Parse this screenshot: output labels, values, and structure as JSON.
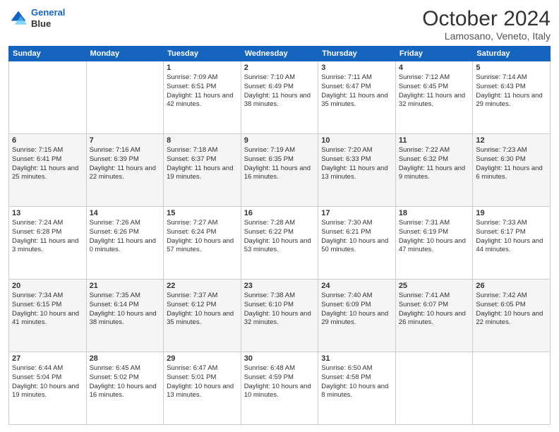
{
  "header": {
    "logo_line1": "General",
    "logo_line2": "Blue",
    "month": "October 2024",
    "location": "Lamosano, Veneto, Italy"
  },
  "weekdays": [
    "Sunday",
    "Monday",
    "Tuesday",
    "Wednesday",
    "Thursday",
    "Friday",
    "Saturday"
  ],
  "weeks": [
    [
      {
        "day": "",
        "sunrise": "",
        "sunset": "",
        "daylight": ""
      },
      {
        "day": "",
        "sunrise": "",
        "sunset": "",
        "daylight": ""
      },
      {
        "day": "1",
        "sunrise": "Sunrise: 7:09 AM",
        "sunset": "Sunset: 6:51 PM",
        "daylight": "Daylight: 11 hours and 42 minutes."
      },
      {
        "day": "2",
        "sunrise": "Sunrise: 7:10 AM",
        "sunset": "Sunset: 6:49 PM",
        "daylight": "Daylight: 11 hours and 38 minutes."
      },
      {
        "day": "3",
        "sunrise": "Sunrise: 7:11 AM",
        "sunset": "Sunset: 6:47 PM",
        "daylight": "Daylight: 11 hours and 35 minutes."
      },
      {
        "day": "4",
        "sunrise": "Sunrise: 7:12 AM",
        "sunset": "Sunset: 6:45 PM",
        "daylight": "Daylight: 11 hours and 32 minutes."
      },
      {
        "day": "5",
        "sunrise": "Sunrise: 7:14 AM",
        "sunset": "Sunset: 6:43 PM",
        "daylight": "Daylight: 11 hours and 29 minutes."
      }
    ],
    [
      {
        "day": "6",
        "sunrise": "Sunrise: 7:15 AM",
        "sunset": "Sunset: 6:41 PM",
        "daylight": "Daylight: 11 hours and 25 minutes."
      },
      {
        "day": "7",
        "sunrise": "Sunrise: 7:16 AM",
        "sunset": "Sunset: 6:39 PM",
        "daylight": "Daylight: 11 hours and 22 minutes."
      },
      {
        "day": "8",
        "sunrise": "Sunrise: 7:18 AM",
        "sunset": "Sunset: 6:37 PM",
        "daylight": "Daylight: 11 hours and 19 minutes."
      },
      {
        "day": "9",
        "sunrise": "Sunrise: 7:19 AM",
        "sunset": "Sunset: 6:35 PM",
        "daylight": "Daylight: 11 hours and 16 minutes."
      },
      {
        "day": "10",
        "sunrise": "Sunrise: 7:20 AM",
        "sunset": "Sunset: 6:33 PM",
        "daylight": "Daylight: 11 hours and 13 minutes."
      },
      {
        "day": "11",
        "sunrise": "Sunrise: 7:22 AM",
        "sunset": "Sunset: 6:32 PM",
        "daylight": "Daylight: 11 hours and 9 minutes."
      },
      {
        "day": "12",
        "sunrise": "Sunrise: 7:23 AM",
        "sunset": "Sunset: 6:30 PM",
        "daylight": "Daylight: 11 hours and 6 minutes."
      }
    ],
    [
      {
        "day": "13",
        "sunrise": "Sunrise: 7:24 AM",
        "sunset": "Sunset: 6:28 PM",
        "daylight": "Daylight: 11 hours and 3 minutes."
      },
      {
        "day": "14",
        "sunrise": "Sunrise: 7:26 AM",
        "sunset": "Sunset: 6:26 PM",
        "daylight": "Daylight: 11 hours and 0 minutes."
      },
      {
        "day": "15",
        "sunrise": "Sunrise: 7:27 AM",
        "sunset": "Sunset: 6:24 PM",
        "daylight": "Daylight: 10 hours and 57 minutes."
      },
      {
        "day": "16",
        "sunrise": "Sunrise: 7:28 AM",
        "sunset": "Sunset: 6:22 PM",
        "daylight": "Daylight: 10 hours and 53 minutes."
      },
      {
        "day": "17",
        "sunrise": "Sunrise: 7:30 AM",
        "sunset": "Sunset: 6:21 PM",
        "daylight": "Daylight: 10 hours and 50 minutes."
      },
      {
        "day": "18",
        "sunrise": "Sunrise: 7:31 AM",
        "sunset": "Sunset: 6:19 PM",
        "daylight": "Daylight: 10 hours and 47 minutes."
      },
      {
        "day": "19",
        "sunrise": "Sunrise: 7:33 AM",
        "sunset": "Sunset: 6:17 PM",
        "daylight": "Daylight: 10 hours and 44 minutes."
      }
    ],
    [
      {
        "day": "20",
        "sunrise": "Sunrise: 7:34 AM",
        "sunset": "Sunset: 6:15 PM",
        "daylight": "Daylight: 10 hours and 41 minutes."
      },
      {
        "day": "21",
        "sunrise": "Sunrise: 7:35 AM",
        "sunset": "Sunset: 6:14 PM",
        "daylight": "Daylight: 10 hours and 38 minutes."
      },
      {
        "day": "22",
        "sunrise": "Sunrise: 7:37 AM",
        "sunset": "Sunset: 6:12 PM",
        "daylight": "Daylight: 10 hours and 35 minutes."
      },
      {
        "day": "23",
        "sunrise": "Sunrise: 7:38 AM",
        "sunset": "Sunset: 6:10 PM",
        "daylight": "Daylight: 10 hours and 32 minutes."
      },
      {
        "day": "24",
        "sunrise": "Sunrise: 7:40 AM",
        "sunset": "Sunset: 6:09 PM",
        "daylight": "Daylight: 10 hours and 29 minutes."
      },
      {
        "day": "25",
        "sunrise": "Sunrise: 7:41 AM",
        "sunset": "Sunset: 6:07 PM",
        "daylight": "Daylight: 10 hours and 26 minutes."
      },
      {
        "day": "26",
        "sunrise": "Sunrise: 7:42 AM",
        "sunset": "Sunset: 6:05 PM",
        "daylight": "Daylight: 10 hours and 22 minutes."
      }
    ],
    [
      {
        "day": "27",
        "sunrise": "Sunrise: 6:44 AM",
        "sunset": "Sunset: 5:04 PM",
        "daylight": "Daylight: 10 hours and 19 minutes."
      },
      {
        "day": "28",
        "sunrise": "Sunrise: 6:45 AM",
        "sunset": "Sunset: 5:02 PM",
        "daylight": "Daylight: 10 hours and 16 minutes."
      },
      {
        "day": "29",
        "sunrise": "Sunrise: 6:47 AM",
        "sunset": "Sunset: 5:01 PM",
        "daylight": "Daylight: 10 hours and 13 minutes."
      },
      {
        "day": "30",
        "sunrise": "Sunrise: 6:48 AM",
        "sunset": "Sunset: 4:59 PM",
        "daylight": "Daylight: 10 hours and 10 minutes."
      },
      {
        "day": "31",
        "sunrise": "Sunrise: 6:50 AM",
        "sunset": "Sunset: 4:58 PM",
        "daylight": "Daylight: 10 hours and 8 minutes."
      },
      {
        "day": "",
        "sunrise": "",
        "sunset": "",
        "daylight": ""
      },
      {
        "day": "",
        "sunrise": "",
        "sunset": "",
        "daylight": ""
      }
    ]
  ]
}
